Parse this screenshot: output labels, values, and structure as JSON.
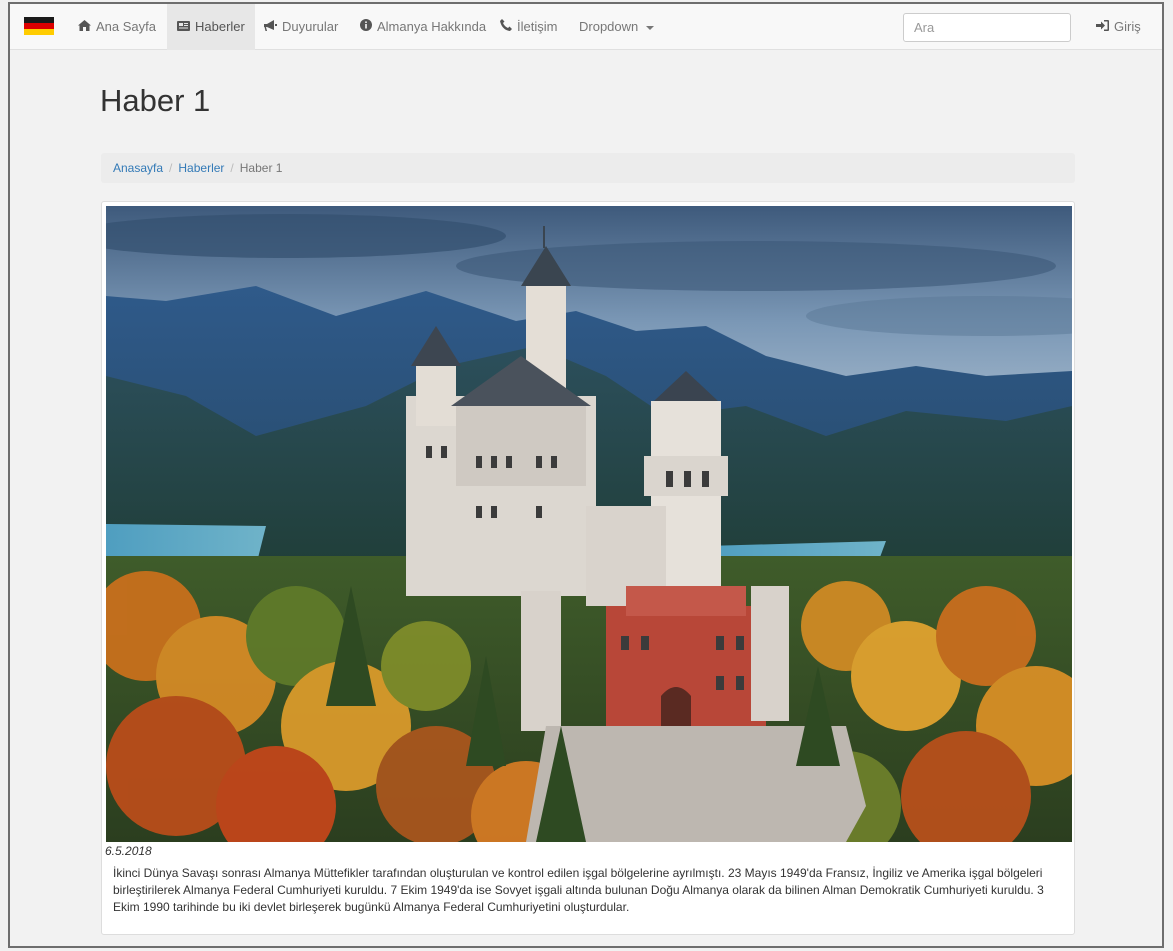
{
  "navbar": {
    "items": [
      {
        "label": "Ana Sayfa",
        "icon": "home-icon"
      },
      {
        "label": "Haberler",
        "icon": "newspaper-icon",
        "active": true
      },
      {
        "label": "Duyurular",
        "icon": "bullhorn-icon"
      },
      {
        "label": "Almanya Hakkında",
        "icon": "info-circle-icon"
      },
      {
        "label": "İletişim",
        "icon": "phone-icon"
      },
      {
        "label": "Dropdown",
        "icon": "caret-down-icon"
      }
    ],
    "search_placeholder": "Ara",
    "login_label": "Giriş",
    "flag_colors": [
      "#1a1a1a",
      "#dd0000",
      "#ffcc00"
    ]
  },
  "page": {
    "title": "Haber 1",
    "breadcrumb": [
      "Anasayfa",
      "Haberler",
      "Haber 1"
    ]
  },
  "article": {
    "date": "6.5.2018",
    "text": "İkinci Dünya Savaşı sonrası Almanya Müttefikler tarafından oluşturulan ve kontrol edilen işgal bölgelerine ayrılmıştı. 23 Mayıs 1949'da Fransız, İngiliz ve Amerika işgal bölgeleri birleştirilerek Almanya Federal Cumhuriyeti kuruldu. 7 Ekim 1949'da ise Sovyet işgali altında bulunan Doğu Almanya olarak da bilinen Alman Demokratik Cumhuriyeti kuruldu. 3 Ekim 1990 tarihinde bu iki devlet birleşerek bugünkü Almanya Federal Cumhuriyetini oluşturdular."
  }
}
